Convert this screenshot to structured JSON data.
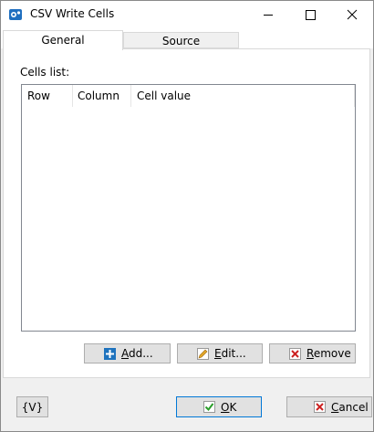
{
  "window": {
    "title": "CSV Write Cells"
  },
  "titlebar": {
    "icons": [
      "app-icon",
      "minimize-icon",
      "maximize-icon",
      "close-icon"
    ]
  },
  "tabs": [
    {
      "label": "General",
      "selected": true
    },
    {
      "label": "Source",
      "selected": false
    }
  ],
  "cells": {
    "label": "Cells list:",
    "columns": [
      "Row",
      "Column",
      "Cell value"
    ],
    "rows": []
  },
  "actions": {
    "add": {
      "first": "A",
      "rest": "dd...",
      "icon": "plus-icon",
      "color": "#1e73be"
    },
    "edit": {
      "first": "E",
      "rest": "dit...",
      "icon": "pencil-icon",
      "color": "#e2a72a"
    },
    "remove": {
      "first": "R",
      "rest": "emove",
      "icon": "x-icon",
      "color": "#cc2222"
    }
  },
  "footer": {
    "variables": "{V}",
    "ok": {
      "first": "O",
      "rest": "K",
      "icon": "check-icon",
      "color": "#2a9d2a"
    },
    "cancel": {
      "first": "C",
      "rest": "ancel",
      "icon": "x-icon",
      "color": "#cc2222"
    }
  }
}
